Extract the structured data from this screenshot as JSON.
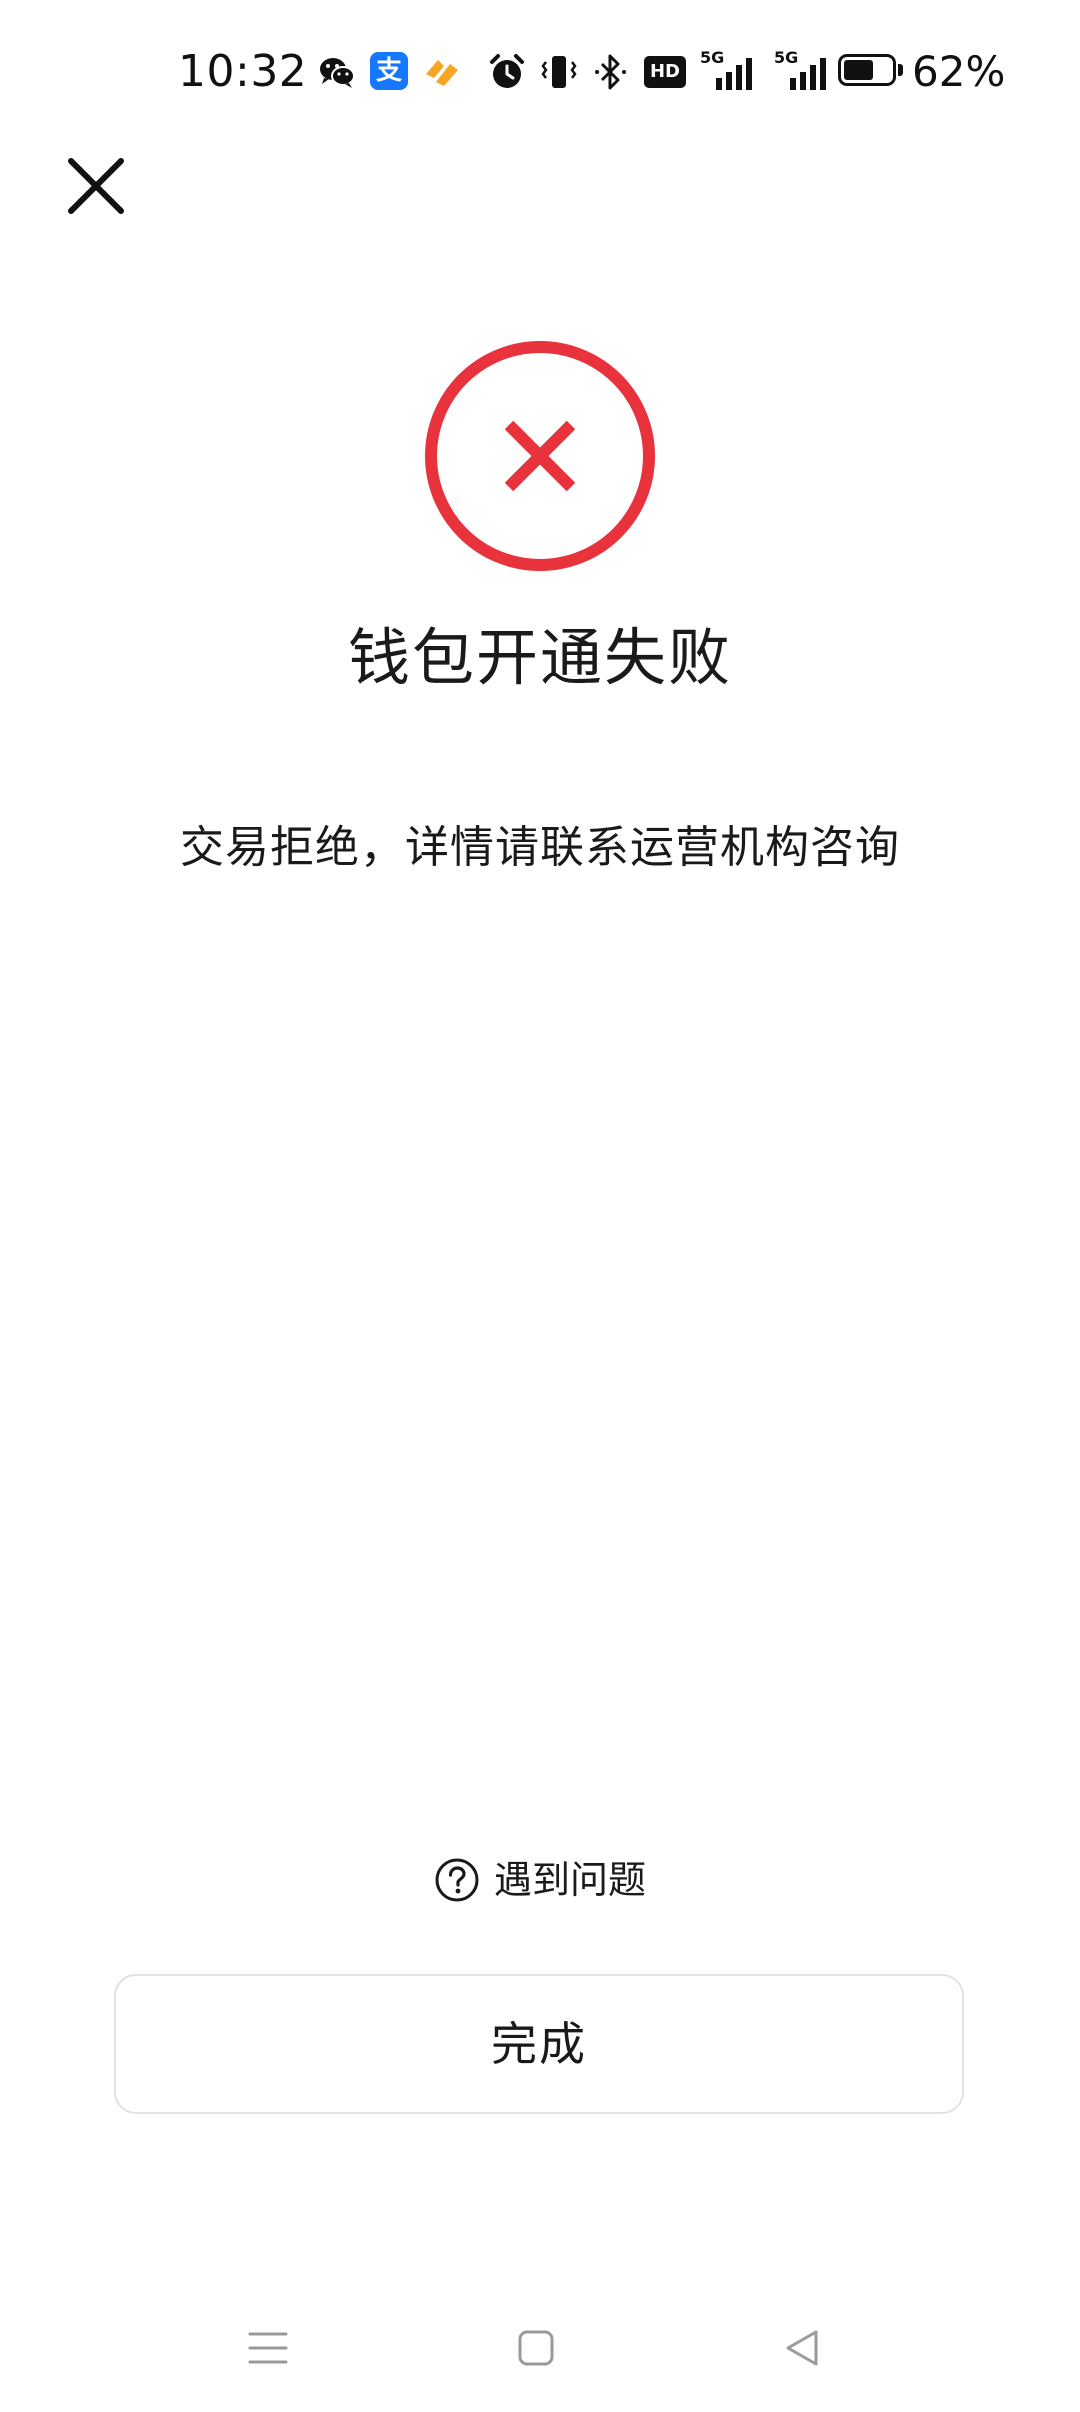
{
  "status_bar": {
    "time": "10:32",
    "battery_percent": "62%",
    "battery_level": 0.62,
    "icons": [
      "wechat-icon",
      "alipay-icon",
      "health-app-icon",
      "alarm-icon",
      "vibrate-icon",
      "bluetooth-icon",
      "hd-voice-icon",
      "signal-5g-icon",
      "signal-5g-icon",
      "battery-icon"
    ],
    "hd_label": "HD",
    "net_label_1": "5G",
    "net_label_2": "5G",
    "alipay_glyph": "支"
  },
  "header": {
    "close_icon": "close-icon"
  },
  "result": {
    "status": "failed",
    "icon": "error-circle-icon",
    "title": "钱包开通失败",
    "message": "交易拒绝，详情请联系运营机构咨询"
  },
  "help": {
    "icon": "question-circle-icon",
    "label": "遇到问题"
  },
  "actions": {
    "done_label": "完成"
  },
  "nav_bar": {
    "items": [
      "menu-icon",
      "home-icon",
      "back-icon"
    ]
  },
  "colors": {
    "error": "#e8323c",
    "text": "#1a1a1a",
    "border": "#e2e2e2",
    "alipay_blue": "#1677ff",
    "health_orange": "#f5a623",
    "nav_gray": "#9a9a9a"
  }
}
